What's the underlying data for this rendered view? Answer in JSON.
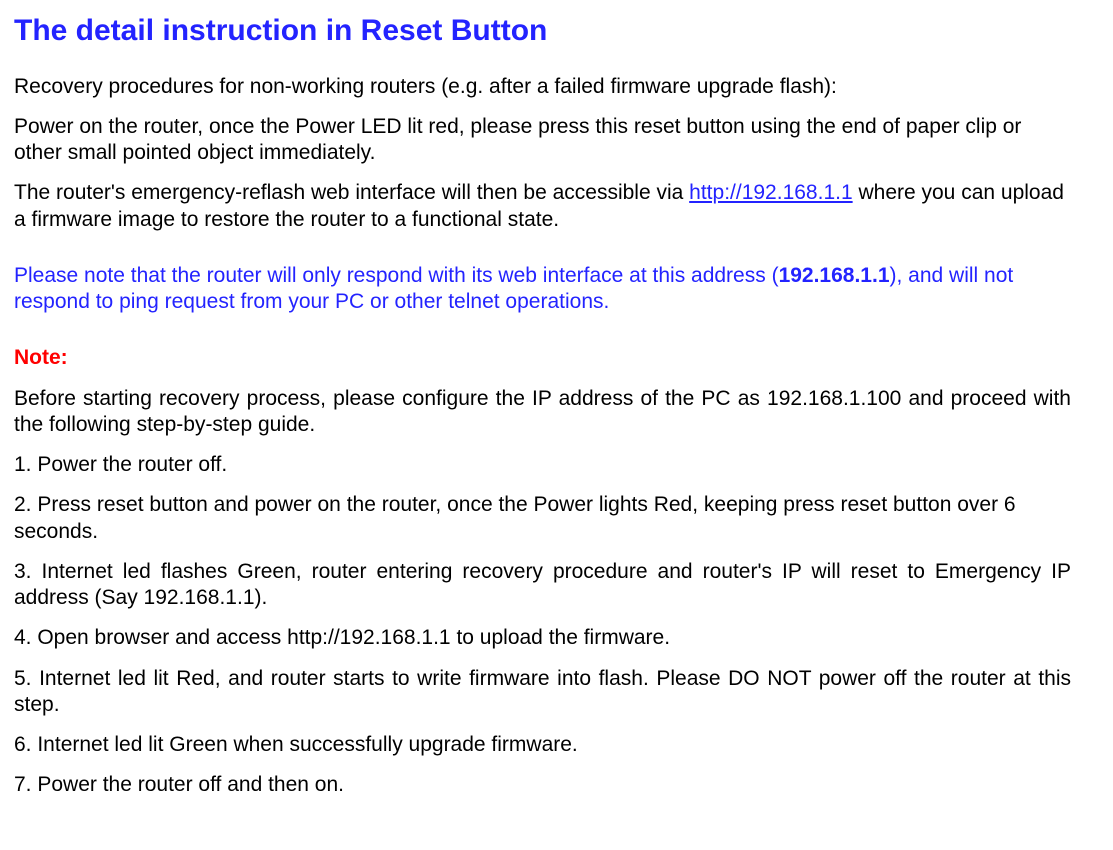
{
  "title": "The detail instruction in Reset Button",
  "intro": "Recovery procedures for non-working routers (e.g. after a failed firmware upgrade flash):",
  "p1": "Power on the router, once the Power LED lit red, please press this reset button using the end of paper clip or other small pointed object immediately.",
  "p2_prefix": "The router's emergency-reflash web interface will then be accessible via ",
  "p2_link_text": "http://192.168.1.1",
  "p2_link_href": "http://192.168.1.1",
  "p2_suffix": " where you can upload a firmware image to restore the router to a functional state.",
  "blue_note_pre": "Please note that the router will only respond with its web interface at this address (",
  "blue_note_ip": "192.168.1.1",
  "blue_note_post": "), and will not respond to ping request from your PC or other telnet operations.",
  "note_label": "Note:",
  "note_body": "Before starting recovery process, please configure the IP address of the PC as 192.168.1.100 and proceed with the following step-by-step guide.",
  "steps": {
    "s1": "1. Power the router off.",
    "s2": "2. Press reset button and power on the router, once the Power lights Red, keeping press reset button over 6 seconds.",
    "s3": "3. Internet led flashes Green, router entering recovery procedure and router's IP will reset to Emergency IP address (Say 192.168.1.1).",
    "s4": "4. Open browser and access http://192.168.1.1 to upload the firmware.",
    "s5": "5. Internet led lit Red, and router starts to write firmware into flash. Please DO NOT power off the router at this step.",
    "s6": "6. Internet led lit Green when successfully upgrade firmware.",
    "s7": "7. Power the router off and then on."
  }
}
